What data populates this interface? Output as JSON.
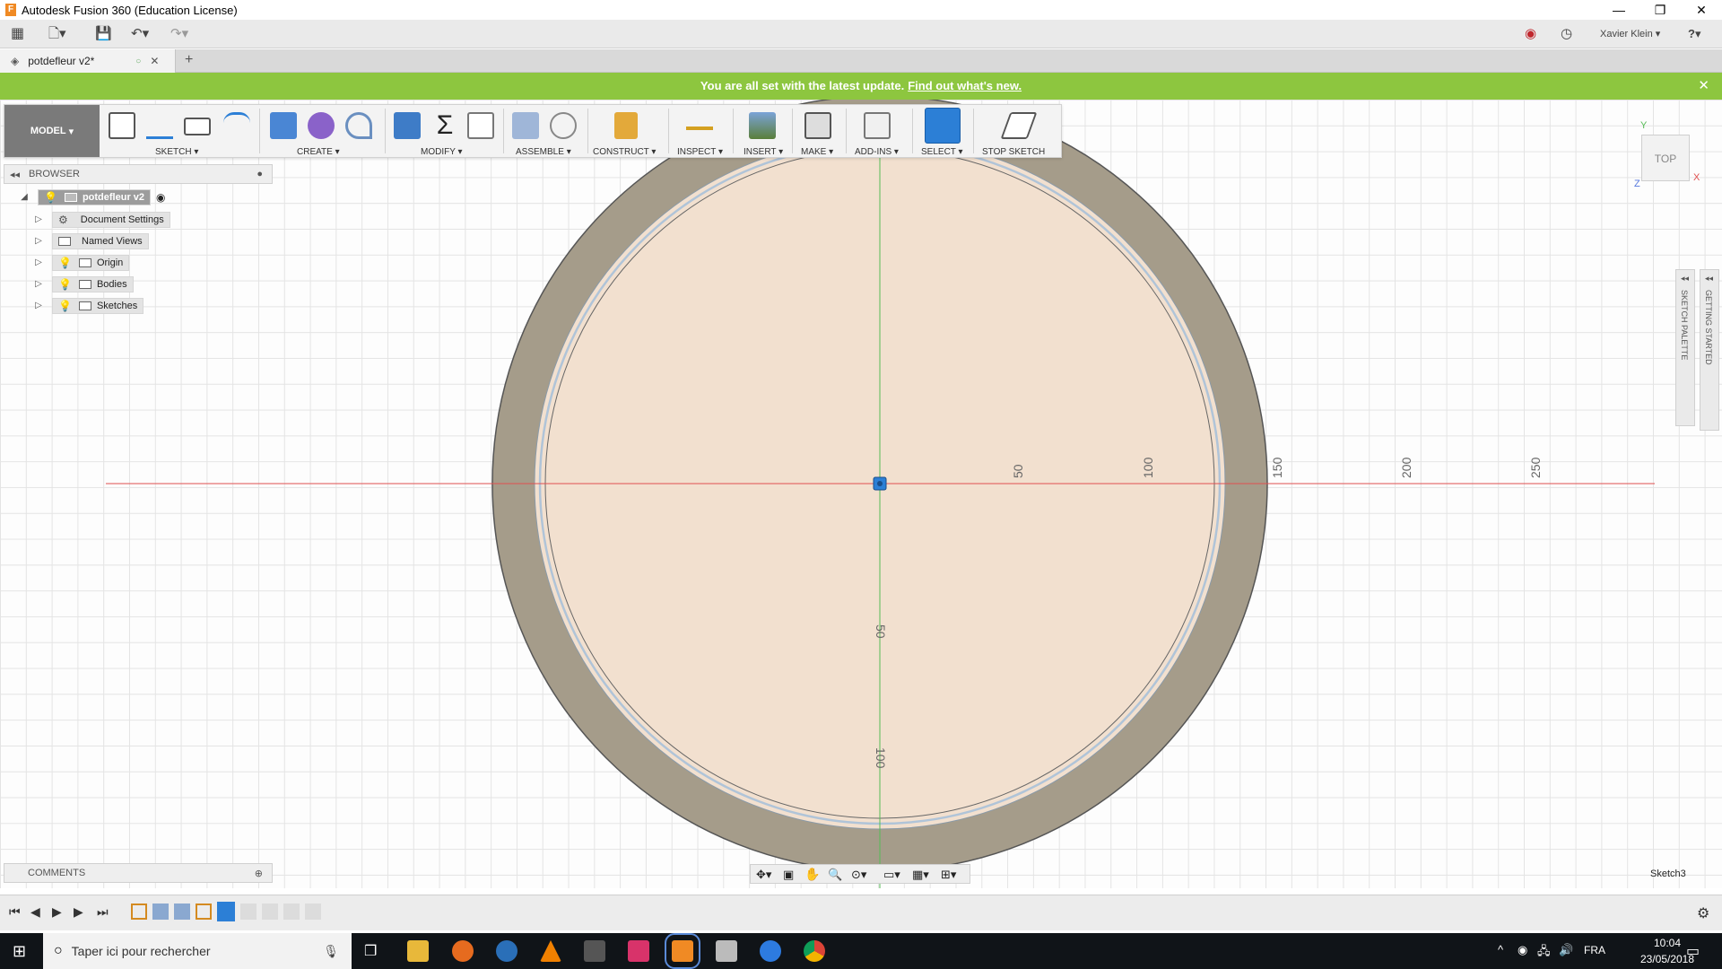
{
  "window": {
    "title": "Autodesk Fusion 360 (Education License)",
    "app_icon_letter": "F"
  },
  "qat": {
    "user": "Xavier Klein",
    "help": "?"
  },
  "tab": {
    "name": "potdefleur v2*",
    "new_tab": "+"
  },
  "update_bar": {
    "message": "You are all set with the latest update.",
    "link": "Find out what's new."
  },
  "toolbar": {
    "mode": "MODEL",
    "groups": {
      "sketch": "SKETCH",
      "create": "CREATE",
      "modify": "MODIFY",
      "assemble": "ASSEMBLE",
      "construct": "CONSTRUCT",
      "inspect": "INSPECT",
      "insert": "INSERT",
      "make": "MAKE",
      "addins": "ADD-INS",
      "select": "SELECT",
      "stop_sketch": "STOP SKETCH"
    }
  },
  "browser": {
    "title": "BROWSER",
    "root": "potdefleur v2",
    "items": [
      "Document Settings",
      "Named Views",
      "Origin",
      "Bodies",
      "Sketches"
    ]
  },
  "comments": {
    "title": "COMMENTS"
  },
  "canvas": {
    "x_ticks": [
      "50",
      "100",
      "150",
      "200",
      "250"
    ],
    "y_ticks": [
      "50",
      "100"
    ],
    "active_sketch": "Sketch3",
    "viewcube": "TOP",
    "axis_y": "Y",
    "axis_x": "X",
    "axis_z": "Z",
    "side_panels": [
      "SKETCH PALETTE",
      "GETTING STARTED"
    ],
    "colors": {
      "outer_ring": "#a59c8a",
      "inner_face": "#f2e0cf",
      "x_axis": "#e05050",
      "y_axis": "#55bb55",
      "select_blue": "#2c7fd6"
    }
  },
  "taskbar": {
    "search_placeholder": "Taper ici pour rechercher",
    "lang": "FRA",
    "time": "10:04",
    "date": "23/05/2018"
  }
}
